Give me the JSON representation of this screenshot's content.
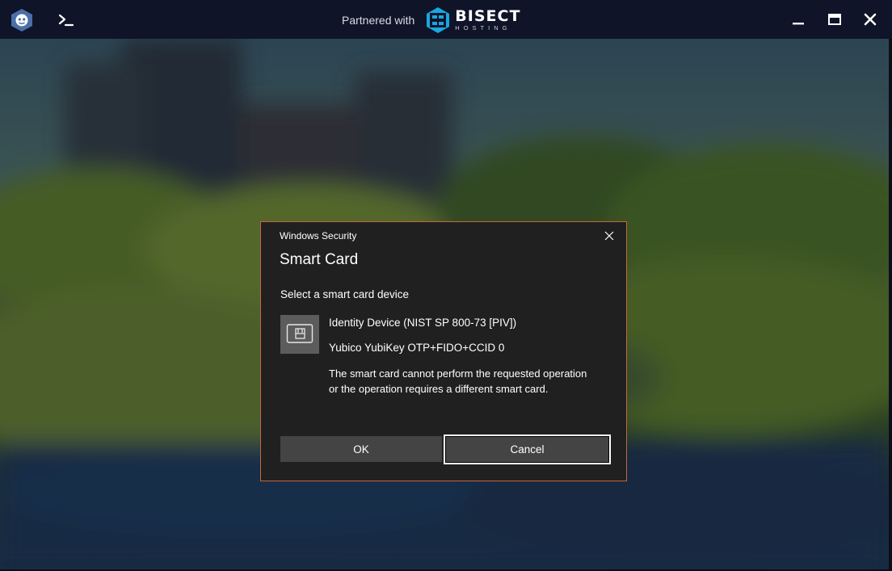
{
  "titlebar": {
    "partner_text": "Partnered with",
    "partner_brand": "BISECT",
    "partner_brand_sub": "HOSTING",
    "icons": [
      "app-logo-icon",
      "terminal-icon",
      "minimize-icon",
      "maximize-icon",
      "close-icon"
    ]
  },
  "dialog": {
    "caption": "Windows Security",
    "title": "Smart Card",
    "prompt": "Select a smart card device",
    "device_name": "Identity Device (NIST SP 800-73 [PIV])",
    "device_sub": "Yubico YubiKey OTP+FIDO+CCID 0",
    "message": "The smart card cannot perform the requested operation or the operation requires a different smart card.",
    "ok_label": "OK",
    "cancel_label": "Cancel",
    "border_color": "#c8653c",
    "background_color": "#202020"
  }
}
